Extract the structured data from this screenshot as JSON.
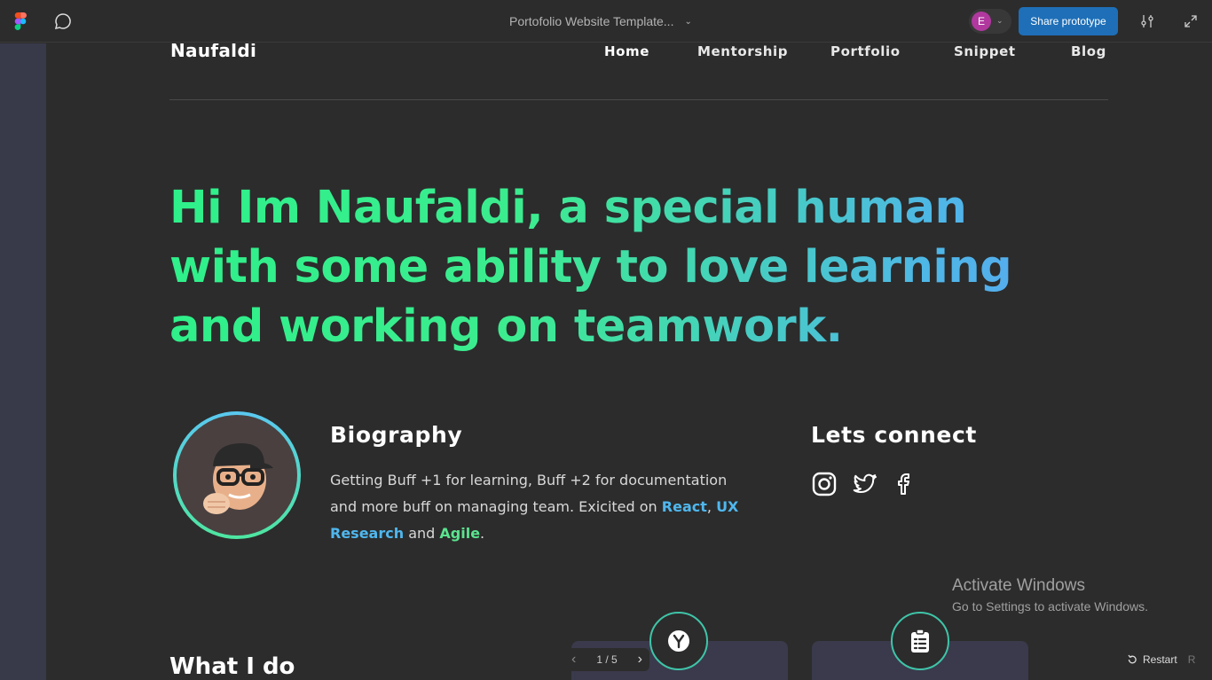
{
  "toolbar": {
    "doc_title": "Portofolio Website Template...",
    "avatar_initial": "E",
    "share_label": "Share prototype"
  },
  "site": {
    "brand": "Naufaldi",
    "nav": [
      "Home",
      "Mentorship",
      "Portfolio",
      "Snippet",
      "Blog"
    ],
    "hero": "Hi Im Naufaldi, a special human with some ability to love learning and working on teamwork.",
    "bio": {
      "title": "Biography",
      "text_1": "Getting Buff +1 for learning, Buff +2 for documentation and more buff on managing team. Exicited on ",
      "link_react": "React",
      "sep": ", ",
      "link_ux": "UX Research",
      "and": " and ",
      "link_agile": "Agile",
      "end": "."
    },
    "connect": {
      "title": "Lets connect",
      "icons": [
        "instagram-icon",
        "twitter-icon",
        "facebook-icon"
      ]
    },
    "whatido": "What I do"
  },
  "player": {
    "page": "1 / 5",
    "restart_label": "Restart",
    "restart_key": "R"
  },
  "watermark": {
    "line1": "Activate Windows",
    "line2": "Go to Settings to activate Windows."
  },
  "colors": {
    "accent_blue": "#4fb7ee",
    "accent_green": "#5ae38e",
    "share_button": "#1e6fb8"
  }
}
